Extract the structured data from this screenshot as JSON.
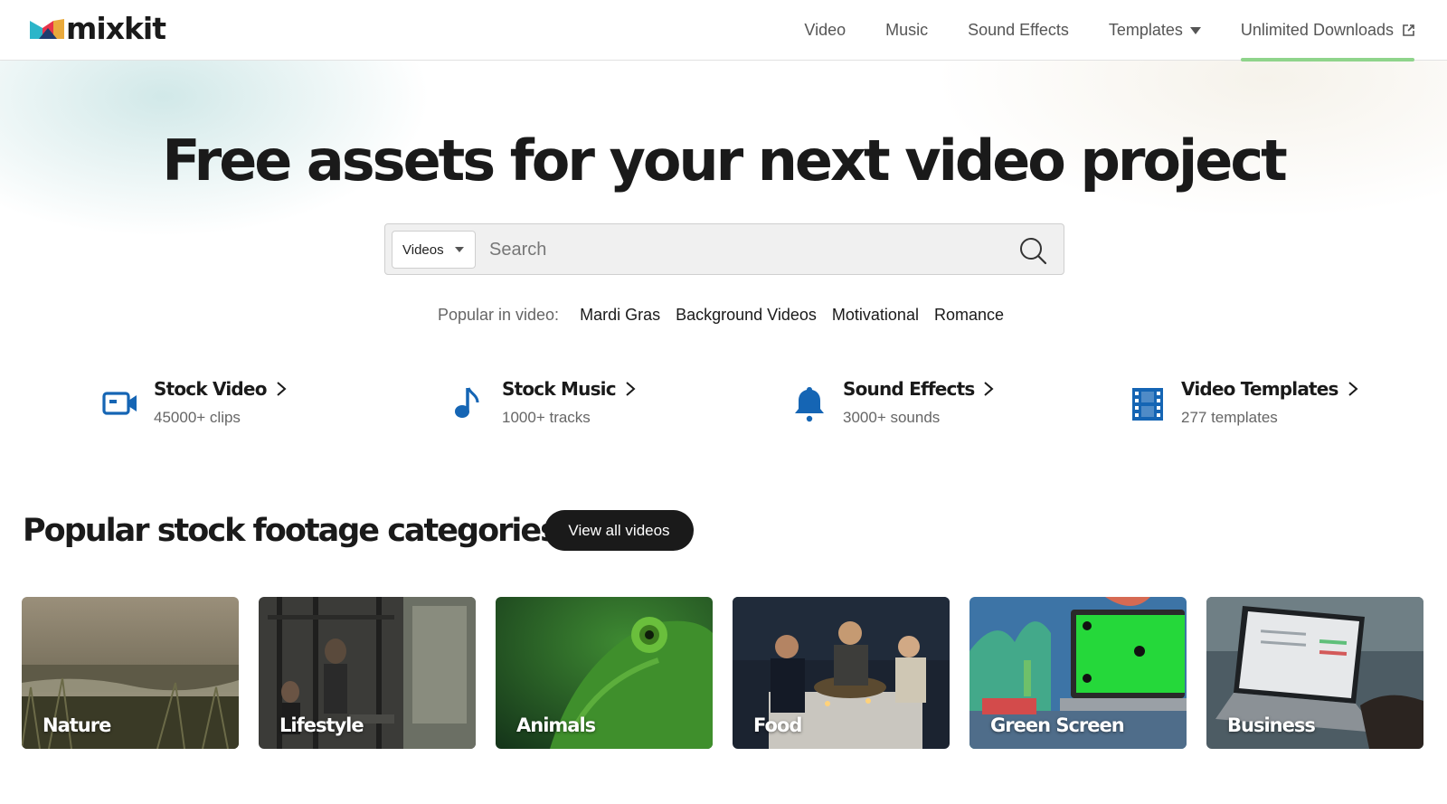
{
  "header": {
    "logo_text": "mixkit",
    "nav": [
      {
        "label": "Video"
      },
      {
        "label": "Music"
      },
      {
        "label": "Sound Effects"
      },
      {
        "label": "Templates"
      },
      {
        "label": "Unlimited Downloads"
      }
    ]
  },
  "hero": {
    "title": "Free assets for your next video project",
    "search": {
      "type_selected": "Videos",
      "placeholder": "Search"
    },
    "popular_label": "Popular in video:",
    "popular_links": [
      "Mardi Gras",
      "Background Videos",
      "Motivational",
      "Romance"
    ]
  },
  "assets": [
    {
      "title": "Stock Video",
      "subtitle": "45000+ clips",
      "icon": "video-camera-icon"
    },
    {
      "title": "Stock Music",
      "subtitle": "1000+ tracks",
      "icon": "music-note-icon"
    },
    {
      "title": "Sound Effects",
      "subtitle": "3000+ sounds",
      "icon": "bell-icon"
    },
    {
      "title": "Video Templates",
      "subtitle": "277 templates",
      "icon": "film-strip-icon"
    }
  ],
  "categories_section": {
    "title": "Popular stock footage categories",
    "view_all_label": "View all videos",
    "cards": [
      {
        "label": "Nature"
      },
      {
        "label": "Lifestyle"
      },
      {
        "label": "Animals"
      },
      {
        "label": "Food"
      },
      {
        "label": "Green Screen"
      },
      {
        "label": "Business"
      }
    ]
  },
  "colors": {
    "brand_dark": "#1a1a1a",
    "icon_blue": "#1565b4",
    "active_underline": "#8fd48b"
  }
}
